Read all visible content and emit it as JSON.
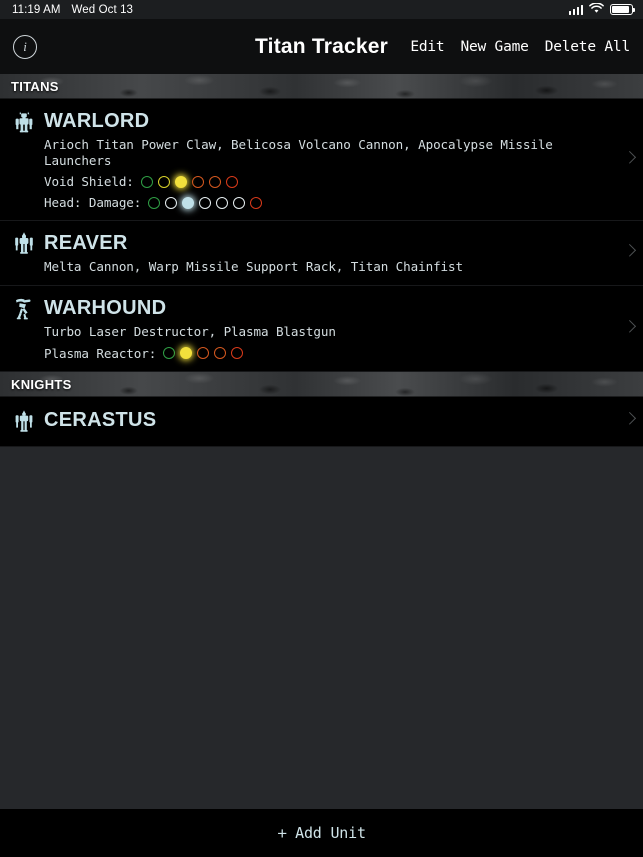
{
  "status_bar": {
    "time": "11:19 AM",
    "date": "Wed Oct 13",
    "signal_icon": "cellular-signal-icon",
    "wifi_icon": "wifi-icon",
    "battery_icon": "battery-icon"
  },
  "nav": {
    "info_icon": "info-circle-icon",
    "info_glyph": "i",
    "title": "Titan Tracker",
    "actions": [
      {
        "label": "Edit",
        "name": "edit-button"
      },
      {
        "label": "New Game",
        "name": "new-game-button"
      },
      {
        "label": "Delete All",
        "name": "delete-all-button"
      }
    ]
  },
  "sections": [
    {
      "header": "TITANS",
      "units": [
        {
          "name": "WARLORD",
          "icon": "warlord-titan-icon",
          "weapons": "Arioch Titan Power Claw, Belicosa Volcano Cannon, Apocalypse Missile Launchers",
          "stats": [
            {
              "label": "Void Shield:",
              "pips": [
                {
                  "color": "#2f9e44",
                  "filled": false
                },
                {
                  "color": "#d9d32a",
                  "filled": false
                },
                {
                  "color": "#f2e03c",
                  "filled": true
                },
                {
                  "color": "#d4581f",
                  "filled": false
                },
                {
                  "color": "#d4581f",
                  "filled": false
                },
                {
                  "color": "#d93a1a",
                  "filled": false
                }
              ]
            },
            {
              "label": "Head: Damage:",
              "pips": [
                {
                  "color": "#2f9e44",
                  "filled": false
                },
                {
                  "color": "#e6eef0",
                  "filled": false
                },
                {
                  "color": "#bfe0e8",
                  "filled": true
                },
                {
                  "color": "#e6eef0",
                  "filled": false
                },
                {
                  "color": "#e6eef0",
                  "filled": false
                },
                {
                  "color": "#e6eef0",
                  "filled": false
                },
                {
                  "color": "#d93a1a",
                  "filled": false
                }
              ]
            }
          ]
        },
        {
          "name": "REAVER",
          "icon": "reaver-titan-icon",
          "weapons": "Melta Cannon, Warp Missile Support Rack, Titan Chainfist",
          "stats": []
        },
        {
          "name": "WARHOUND",
          "icon": "warhound-titan-icon",
          "weapons": "Turbo Laser Destructor, Plasma Blastgun",
          "stats": [
            {
              "label": "Plasma Reactor:",
              "pips": [
                {
                  "color": "#2f9e44",
                  "filled": false
                },
                {
                  "color": "#f2e03c",
                  "filled": true
                },
                {
                  "color": "#d4581f",
                  "filled": false
                },
                {
                  "color": "#d4581f",
                  "filled": false
                },
                {
                  "color": "#d93a1a",
                  "filled": false
                }
              ]
            }
          ]
        }
      ]
    },
    {
      "header": "KNIGHTS",
      "units": [
        {
          "name": "CERASTUS",
          "icon": "knight-cerastus-icon",
          "weapons": "",
          "stats": []
        }
      ]
    }
  ],
  "bottom_bar": {
    "plus_icon": "plus-icon",
    "plus_glyph": "+",
    "add_label": "Add Unit"
  },
  "colors": {
    "accent_text": "#cfe3e8",
    "row_background": "#000000",
    "page_background": "#26282b",
    "nav_background": "#0e0f10"
  }
}
